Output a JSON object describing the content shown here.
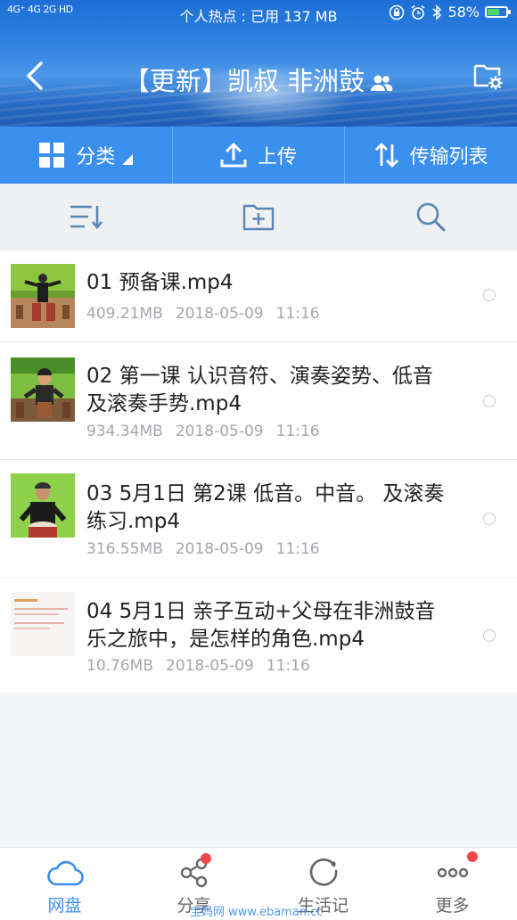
{
  "status_bar": {
    "network": "4G⁺ 4G 2G HD",
    "hotspot_text": "个人热点 : 已用 137 MB",
    "battery_percent": "58%",
    "battery_level": 0.58
  },
  "header": {
    "title": "【更新】凯叔 非洲鼓",
    "back_icon": "chevron-left-icon",
    "shared_icon": "people-icon",
    "folder_settings_icon": "folder-settings-icon"
  },
  "toolbar": {
    "category_label": "分类",
    "upload_label": "上传",
    "transfer_label": "传输列表"
  },
  "actions": {
    "sort_icon": "sort-icon",
    "new_folder_icon": "new-folder-icon",
    "search_icon": "search-icon"
  },
  "files": [
    {
      "name": "01 预备课.mp4",
      "size": "409.21MB",
      "date": "2018-05-09",
      "time": "11:16"
    },
    {
      "name": "02 第一课  认识音符、演奏姿势、低音及滚奏手势.mp4",
      "size": "934.34MB",
      "date": "2018-05-09",
      "time": "11:16"
    },
    {
      "name": "03  5月1日 第2课   低音。中音。 及滚奏练习.mp4",
      "size": "316.55MB",
      "date": "2018-05-09",
      "time": "11:16"
    },
    {
      "name": "04  5月1日 亲子互动+父母在非洲鼓音乐之旅中，是怎样的角色.mp4",
      "size": "10.76MB",
      "date": "2018-05-09",
      "time": "11:16"
    }
  ],
  "bottom_nav": [
    {
      "label": "网盘",
      "icon": "cloud-icon",
      "active": true,
      "badge": false
    },
    {
      "label": "分享",
      "icon": "share-icon",
      "active": false,
      "badge": true
    },
    {
      "label": "生活记",
      "icon": "life-icon",
      "active": false,
      "badge": false
    },
    {
      "label": "更多",
      "icon": "more-icon",
      "active": false,
      "badge": true
    }
  ],
  "watermark": "宝妈网  www.ebaman.cc",
  "colors": {
    "accent": "#3b8fef",
    "badge": "#f04848"
  }
}
